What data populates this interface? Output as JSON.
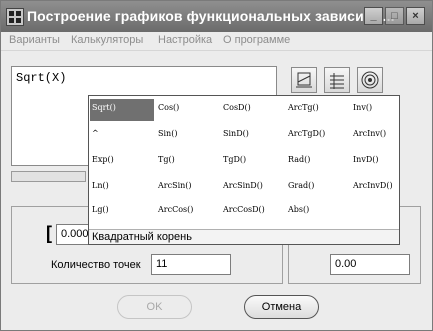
{
  "window": {
    "title": "Построение графиков функциональных зависимо...",
    "minimize_glyph": "_",
    "maximize_glyph": "□",
    "close_glyph": "×"
  },
  "menu": [
    "Варианты",
    "Калькуляторы",
    "Настройка",
    "О программе"
  ],
  "input": {
    "value": "Sqrt(X)"
  },
  "toolbar": {
    "icons": [
      "graph-icon",
      "table-icon",
      "target-icon"
    ]
  },
  "popup": {
    "selected": "Sqrt()",
    "rows": [
      [
        "Sqrt()",
        "Cos()",
        "CosD()",
        "ArcTg()",
        "Inv()"
      ],
      [
        "^",
        "Sin()",
        "SinD()",
        "ArcTgD()",
        "ArcInv()"
      ],
      [
        "Exp()",
        "Tg()",
        "TgD()",
        "Rad()",
        "InvD()"
      ],
      [
        "Ln()",
        "ArcSin()",
        "ArcSinD()",
        "Grad()",
        "ArcInvD()"
      ],
      [
        "Lg()",
        "ArcCos()",
        "ArcCosD()",
        "Abs()",
        ""
      ]
    ],
    "status": "Квадратный корень"
  },
  "range": {
    "bracket": "[",
    "start_value": "0.000",
    "points_label": "Количество точек",
    "points_value": "11",
    "end_value": "0.00"
  },
  "buttons": {
    "ok": "OK",
    "cancel": "Отмена"
  },
  "colors": {
    "titlebar": "#7a7a7a",
    "selection": "#707070"
  }
}
